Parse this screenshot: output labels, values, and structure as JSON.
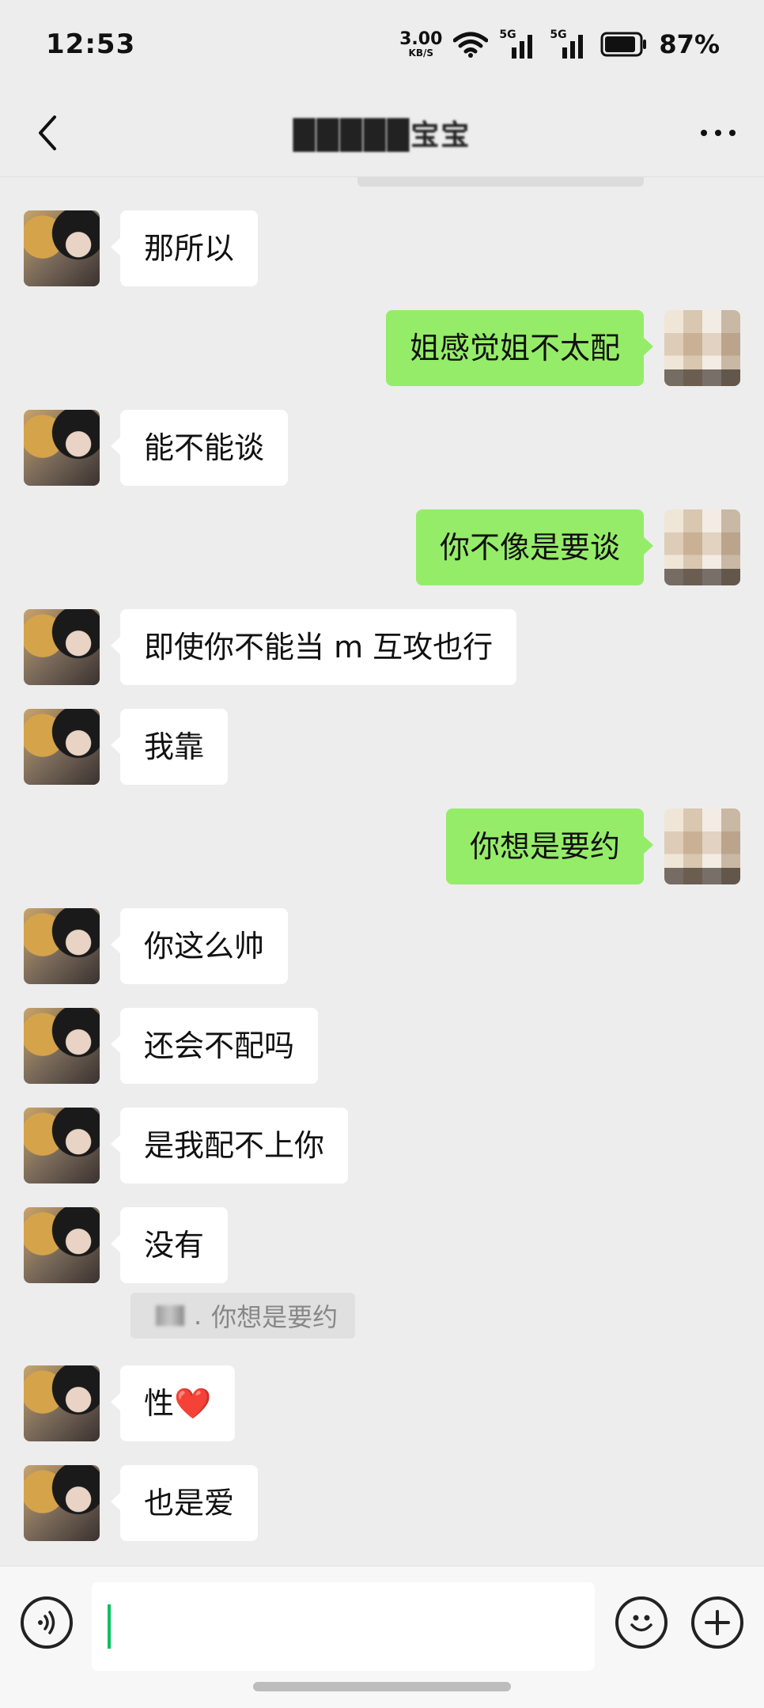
{
  "status": {
    "time": "12:53",
    "net_speed": "3.00",
    "net_unit": "KB/S",
    "signal1": "5G",
    "signal2": "5G",
    "battery": "87%"
  },
  "header": {
    "title": "█████宝宝"
  },
  "messages": [
    {
      "side": "peer",
      "text": "那所以"
    },
    {
      "side": "self",
      "text": "姐感觉姐不太配"
    },
    {
      "side": "peer",
      "text": "能不能谈"
    },
    {
      "side": "self",
      "text": "你不像是要谈"
    },
    {
      "side": "peer",
      "text": "即使你不能当 m 互攻也行"
    },
    {
      "side": "peer",
      "text": "我靠"
    },
    {
      "side": "self",
      "text": "你想是要约"
    },
    {
      "side": "peer",
      "text": "你这么帅"
    },
    {
      "side": "peer",
      "text": "还会不配吗"
    },
    {
      "side": "peer",
      "text": "是我配不上你"
    },
    {
      "side": "peer",
      "text": "没有"
    },
    {
      "side": "peer",
      "text": "性❤️"
    },
    {
      "side": "peer",
      "text": "也是爱"
    }
  ],
  "quote": {
    "separator": ".",
    "text": "你想是要约"
  },
  "icons": {
    "back": "back-arrow-icon",
    "more": "more-icon",
    "voice": "voice-icon",
    "emoji": "emoji-icon",
    "plus": "plus-icon"
  },
  "colors": {
    "self_bubble": "#95ec69",
    "peer_bubble": "#ffffff",
    "background": "#ededed",
    "cursor": "#07c160"
  }
}
